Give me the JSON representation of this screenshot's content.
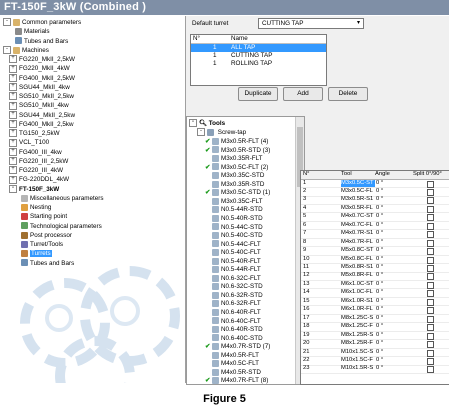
{
  "window": {
    "title": "FT-150F_3kW (Combined )"
  },
  "left_tree": {
    "nodes": [
      {
        "label": "Common parameters",
        "indent": 0,
        "toggle": "-",
        "icon": "folder-icon"
      },
      {
        "label": "Materials",
        "indent": 2,
        "toggle": "",
        "icon": "materials-icon"
      },
      {
        "label": "Tubes and Bars",
        "indent": 2,
        "toggle": "",
        "icon": "tubes-icon"
      },
      {
        "label": "Machines",
        "indent": 0,
        "toggle": "-",
        "icon": "folder-icon"
      },
      {
        "label": "FG220_MkII_2,5kW",
        "indent": 1,
        "toggle": "+",
        "icon": ""
      },
      {
        "label": "FG220_MkII_4kW",
        "indent": 1,
        "toggle": "+",
        "icon": ""
      },
      {
        "label": "FG400_MkII_2,5kW",
        "indent": 1,
        "toggle": "+",
        "icon": ""
      },
      {
        "label": "SGU44_MkII_4kw",
        "indent": 1,
        "toggle": "+",
        "icon": ""
      },
      {
        "label": "SG510_MkII_2,5kw",
        "indent": 1,
        "toggle": "+",
        "icon": ""
      },
      {
        "label": "SG510_MkII_4kw",
        "indent": 1,
        "toggle": "+",
        "icon": ""
      },
      {
        "label": "SGU44_MkII_2,5kw",
        "indent": 1,
        "toggle": "+",
        "icon": ""
      },
      {
        "label": "FG400_MkII_2,5kw",
        "indent": 1,
        "toggle": "+",
        "icon": ""
      },
      {
        "label": "TG150_2,5kW",
        "indent": 1,
        "toggle": "+",
        "icon": ""
      },
      {
        "label": "VCL_T100",
        "indent": 1,
        "toggle": "+",
        "icon": ""
      },
      {
        "label": "FG400_III_4kw",
        "indent": 1,
        "toggle": "+",
        "icon": ""
      },
      {
        "label": "FG220_III_2,5kW",
        "indent": 1,
        "toggle": "+",
        "icon": ""
      },
      {
        "label": "FG220_III_4kW",
        "indent": 1,
        "toggle": "+",
        "icon": ""
      },
      {
        "label": "FG-220DDL_4kW",
        "indent": 1,
        "toggle": "+",
        "icon": ""
      },
      {
        "label": "FT-150F_3kW",
        "indent": 1,
        "toggle": "-",
        "icon": "",
        "bold": true
      },
      {
        "label": "Miscellaneous parameters",
        "indent": 3,
        "toggle": "",
        "icon": "misc-icon"
      },
      {
        "label": "Nesting",
        "indent": 3,
        "toggle": "",
        "icon": "nesting-icon"
      },
      {
        "label": "Starting point",
        "indent": 3,
        "toggle": "",
        "icon": "start-point-icon"
      },
      {
        "label": "Technological parameters",
        "indent": 3,
        "toggle": "",
        "icon": "tech-icon"
      },
      {
        "label": "Post processor",
        "indent": 3,
        "toggle": "",
        "icon": "post-icon"
      },
      {
        "label": "Turret/Tools",
        "indent": 3,
        "toggle": "",
        "icon": "turret-icon"
      },
      {
        "label": "Turrets",
        "indent": 3,
        "toggle": "",
        "icon": "turrets-icon",
        "selected": true
      },
      {
        "label": "Tubes and Bars",
        "indent": 3,
        "toggle": "",
        "icon": "tubes-icon"
      }
    ]
  },
  "turret": {
    "label": "Default turret",
    "value": "CUTTING TAP",
    "list_headers": [
      "N°",
      "Name"
    ],
    "list_rows": [
      {
        "n": "1",
        "name": "ALL TAP",
        "selected": true
      },
      {
        "n": "1",
        "name": "CUTTING TAP",
        "selected": false
      },
      {
        "n": "1",
        "name": "ROLLING TAP",
        "selected": false
      }
    ],
    "buttons": {
      "duplicate": "Duplicate",
      "add": "Add",
      "delete": "Delete"
    }
  },
  "tools_tree": {
    "root": "Tools",
    "group": "Screw-tap",
    "items": [
      {
        "label": "M3x0.5R-FLT (4)",
        "checked": true
      },
      {
        "label": "M3x0.5R-STD (3)",
        "checked": true
      },
      {
        "label": "M3x0.35R-FLT",
        "checked": false
      },
      {
        "label": "M3x0.5C-FLT (2)",
        "checked": true
      },
      {
        "label": "M3x0.35C-STD",
        "checked": false
      },
      {
        "label": "M3x0.35R-STD",
        "checked": false
      },
      {
        "label": "M3x0.5C-STD (1)",
        "checked": true
      },
      {
        "label": "M3x0.35C-FLT",
        "checked": false
      },
      {
        "label": "N0.5-44R-STD",
        "checked": false
      },
      {
        "label": "N0.5-40R-STD",
        "checked": false
      },
      {
        "label": "N0.5-44C-STD",
        "checked": false
      },
      {
        "label": "N0.5-40C-STD",
        "checked": false
      },
      {
        "label": "N0.5-44C-FLT",
        "checked": false
      },
      {
        "label": "N0.5-40C-FLT",
        "checked": false
      },
      {
        "label": "N0.5-40R-FLT",
        "checked": false
      },
      {
        "label": "N0.5-44R-FLT",
        "checked": false
      },
      {
        "label": "N0.6-32C-FLT",
        "checked": false
      },
      {
        "label": "N0.6-32C-STD",
        "checked": false
      },
      {
        "label": "N0.6-32R-STD",
        "checked": false
      },
      {
        "label": "N0.6-32R-FLT",
        "checked": false
      },
      {
        "label": "N0.6-40R-FLT",
        "checked": false
      },
      {
        "label": "N0.6-40C-FLT",
        "checked": false
      },
      {
        "label": "N0.6-40R-STD",
        "checked": false
      },
      {
        "label": "N0.6-40C-STD",
        "checked": false
      },
      {
        "label": "M4x0.7R-STD (7)",
        "checked": true
      },
      {
        "label": "M4x0.5R-FLT",
        "checked": false
      },
      {
        "label": "M4x0.5C-FLT",
        "checked": false
      },
      {
        "label": "M4x0.5R-STD",
        "checked": false
      },
      {
        "label": "M4x0.7R-FLT (8)",
        "checked": true
      }
    ]
  },
  "tool_grid": {
    "headers": [
      "N°",
      "Tool",
      "Angle",
      "Split 0°/90°"
    ],
    "rows": [
      {
        "n": "1",
        "tool": "M3x0.5C-ST",
        "angle": "0 °",
        "selected": true
      },
      {
        "n": "2",
        "tool": "M3x0.5C-FL",
        "angle": "0 °"
      },
      {
        "n": "3",
        "tool": "M3x0.5R-S1",
        "angle": "0 °"
      },
      {
        "n": "4",
        "tool": "M3x0.5R-FL",
        "angle": "0 °"
      },
      {
        "n": "5",
        "tool": "M4x0.7C-ST",
        "angle": "0 °"
      },
      {
        "n": "6",
        "tool": "M4x0.7C-FL",
        "angle": "0 °"
      },
      {
        "n": "7",
        "tool": "M4x0.7R-S1",
        "angle": "0 °"
      },
      {
        "n": "8",
        "tool": "M4x0.7R-FL",
        "angle": "0 °"
      },
      {
        "n": "9",
        "tool": "M5x0.8C-ST",
        "angle": "0 °"
      },
      {
        "n": "10",
        "tool": "M5x0.8C-FL",
        "angle": "0 °"
      },
      {
        "n": "11",
        "tool": "M5x0.8R-S1",
        "angle": "0 °"
      },
      {
        "n": "12",
        "tool": "M5x0.8R-FL",
        "angle": "0 °"
      },
      {
        "n": "13",
        "tool": "M6x1.0C-ST",
        "angle": "0 °"
      },
      {
        "n": "14",
        "tool": "M6x1.0C-FL",
        "angle": "0 °"
      },
      {
        "n": "15",
        "tool": "M6x1.0R-S1",
        "angle": "0 °"
      },
      {
        "n": "16",
        "tool": "M6x1.0R-FL",
        "angle": "0 °"
      },
      {
        "n": "17",
        "tool": "M8x1.25C-S",
        "angle": "0 °"
      },
      {
        "n": "18",
        "tool": "M8x1.25C-F",
        "angle": "0 °"
      },
      {
        "n": "19",
        "tool": "M8x1.25R-S",
        "angle": "0 °"
      },
      {
        "n": "20",
        "tool": "M8x1.25R-F",
        "angle": "0 °"
      },
      {
        "n": "21",
        "tool": "M10x1.5C-S",
        "angle": "0 °"
      },
      {
        "n": "22",
        "tool": "M10x1.5C-F",
        "angle": "0 °"
      },
      {
        "n": "23",
        "tool": "M10x1.5R-S",
        "angle": "0 °"
      }
    ]
  },
  "caption": "Figure 5",
  "colors": {
    "titlebar": "#7f8fa6",
    "selection": "#3399ff",
    "check": "#1a9a1a"
  }
}
